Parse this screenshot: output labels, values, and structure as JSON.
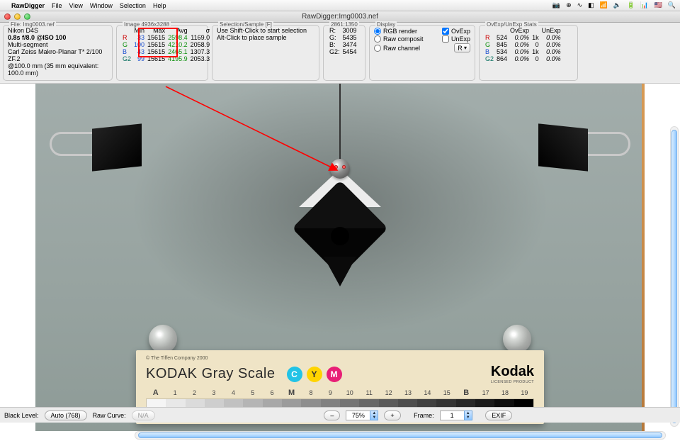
{
  "menubar": {
    "app": "RawDigger",
    "items": [
      "File",
      "View",
      "Window",
      "Selection",
      "Help"
    ],
    "right_icons": [
      "📷",
      "⊕",
      "∿",
      "◧",
      "📶",
      "🔈",
      "🔋",
      "📊",
      "🇺🇸",
      "🔍"
    ]
  },
  "window": {
    "title": "RawDigger:Img0003.nef"
  },
  "panels": {
    "file": {
      "title": "File: Img0003.nef",
      "lines": [
        "Nikon D4S",
        "0.8s f/8.0 @ISO 100",
        "Multi-segment",
        "Carl Zeiss Makro-Planar T* 2/100 ZF.2",
        "@100.0 mm (35 mm equivalent: 100.0 mm)"
      ]
    },
    "image": {
      "title": "Image 4936x3288",
      "headers": [
        "",
        "Min",
        "Max",
        "Avg",
        "σ"
      ],
      "rows": [
        {
          "ch": "R",
          "min": "33",
          "max": "15615",
          "avg": "2598.4",
          "sigma": "1169.0"
        },
        {
          "ch": "G",
          "min": "100",
          "max": "15615",
          "avg": "4210.2",
          "sigma": "2058.9"
        },
        {
          "ch": "B",
          "min": "43",
          "max": "15615",
          "avg": "2465.1",
          "sigma": "1307.3"
        },
        {
          "ch": "G2",
          "min": "99",
          "max": "15615",
          "avg": "4195.9",
          "sigma": "2053.3"
        }
      ]
    },
    "selection": {
      "title": "Selection/Sample [F]",
      "line1": "Use Shift-Click to start selection",
      "line2": "Alt-Click to place sample"
    },
    "coords": {
      "title": "2861:1350",
      "rows": [
        {
          "ch": "R:",
          "v": "3009"
        },
        {
          "ch": "G:",
          "v": "5435"
        },
        {
          "ch": "B:",
          "v": "3474"
        },
        {
          "ch": "G2:",
          "v": "5454"
        }
      ]
    },
    "display": {
      "title": "Display",
      "rgb_render": "RGB render",
      "ovexp": "OvExp",
      "raw_composit": "Raw composit",
      "unexp": "UnExp",
      "raw_channel": "Raw channel",
      "channel_sel": "R"
    },
    "stats": {
      "title": "OvExp/UnExp Stats",
      "headers": [
        "",
        "",
        "OvExp",
        "",
        "UnExp"
      ],
      "rows": [
        {
          "ch": "R",
          "cnt": "524",
          "ov": "0.0%",
          "ucnt": "1k",
          "un": "0.0%"
        },
        {
          "ch": "G",
          "cnt": "845",
          "ov": "0.0%",
          "ucnt": "0",
          "un": "0.0%"
        },
        {
          "ch": "B",
          "cnt": "534",
          "ov": "0.0%",
          "ucnt": "1k",
          "un": "0.0%"
        },
        {
          "ch": "G2",
          "cnt": "864",
          "ov": "0.0%",
          "ucnt": "0",
          "un": "0.0%"
        }
      ]
    }
  },
  "card": {
    "tiffen": "© The Tiffen Company 2000",
    "title": "KODAK Gray Scale",
    "cmy": [
      "C",
      "Y",
      "M"
    ],
    "brand": "Kodak",
    "brand_sub": "LICENSED PRODUCT",
    "labels": [
      "A",
      "1",
      "2",
      "3",
      "4",
      "5",
      "6",
      "M",
      "8",
      "9",
      "10",
      "11",
      "12",
      "13",
      "14",
      "15",
      "B",
      "17",
      "18",
      "19"
    ]
  },
  "bottom": {
    "black_level_lbl": "Black Level:",
    "black_level_btn": "Auto (768)",
    "raw_curve_lbl": "Raw Curve:",
    "raw_curve_btn": "N/A",
    "zoom": "75%",
    "frame_lbl": "Frame:",
    "frame_val": "1",
    "exif": "EXIF"
  }
}
